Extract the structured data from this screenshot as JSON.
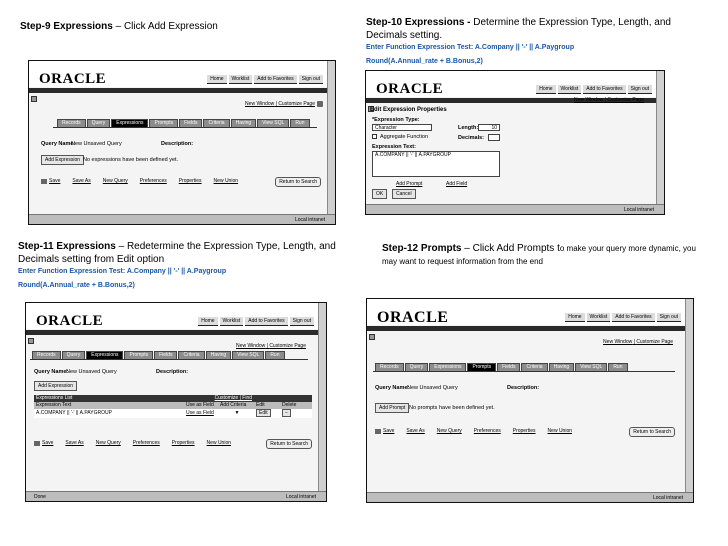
{
  "captions": {
    "step9": {
      "title": "Step-9 Expressions",
      "dash": " – ",
      "rest": "Click Add Expression"
    },
    "step10": {
      "title": "Step-10 Expressions - ",
      "rest": "Determine the Expression Type, Length, and Decimals setting.",
      "line1": "Enter Function Expression Test: A.Company || '-' || A.Paygroup",
      "line2": "Round(A.Annual_rate + B.Bonus,2)"
    },
    "step11": {
      "title": "Step-11 Expressions",
      "dash": " – ",
      "rest": "Redetermine the Expression Type, Length, and Decimals setting from Edit option",
      "line1": "Enter Function Expression Test: A.Company || '-' || A.Paygroup",
      "line2": "Round(A.Annual_rate + B.Bonus,2)"
    },
    "step12": {
      "title": "Step-12 Prompts",
      "dash": " – ",
      "rest": "Click Add Prompts t",
      "rest2": "o make your query more dynamic, you may want to request information from the end"
    }
  },
  "oracle": {
    "logo": "ORACLE",
    "toplinks": [
      "Home",
      "Worklist",
      "Add to Favorites",
      "Sign out"
    ],
    "new_window": "New Window",
    "customize": "Customize Page",
    "local_intranet": "Local intranet",
    "done": "Done",
    "tabs": [
      "Records",
      "Query",
      "Expressions",
      "Prompts",
      "Fields",
      "Criteria",
      "Having",
      "View SQL",
      "Run"
    ],
    "query_name_label": "Query Name:",
    "query_name_value": "New Unsaved Query",
    "description_label": "Description:",
    "add_expression": "Add Expression",
    "add_prompt": "Add Prompt",
    "no_expressions": "No expressions have been defined yet.",
    "no_prompts": "No prompts have been defined yet.",
    "footer_links": [
      "Save",
      "Save As",
      "New Query",
      "Preferences",
      "Properties",
      "New Union"
    ],
    "return_search": "Return to Search"
  },
  "edit_expr": {
    "title": "Edit Expression Properties",
    "type_label": "*Expression Type:",
    "type_value": "Character",
    "length_label": "Length:",
    "length_value": "10",
    "aggregate_label": "Aggregate Function",
    "decimals_label": "Decimals:",
    "text_label": "Expression Text:",
    "text_value": "A.COMPANY || '-' || A.PAYGROUP",
    "add_prompt": "Add Prompt",
    "add_field": "Add Field",
    "ok": "OK",
    "cancel": "Cancel"
  },
  "expr_list": {
    "title": "Expressions List",
    "customize": "Customize | Find",
    "col_text": "Expression Text",
    "col_use": "Use as Field",
    "col_criteria": "Add Criteria",
    "col_edit": "Edit",
    "col_delete": "Delete",
    "row_text": "A.COMPANY || '-' || A.PAYGROUP",
    "row_use": "Use as Field",
    "row_edit": "Edit"
  }
}
